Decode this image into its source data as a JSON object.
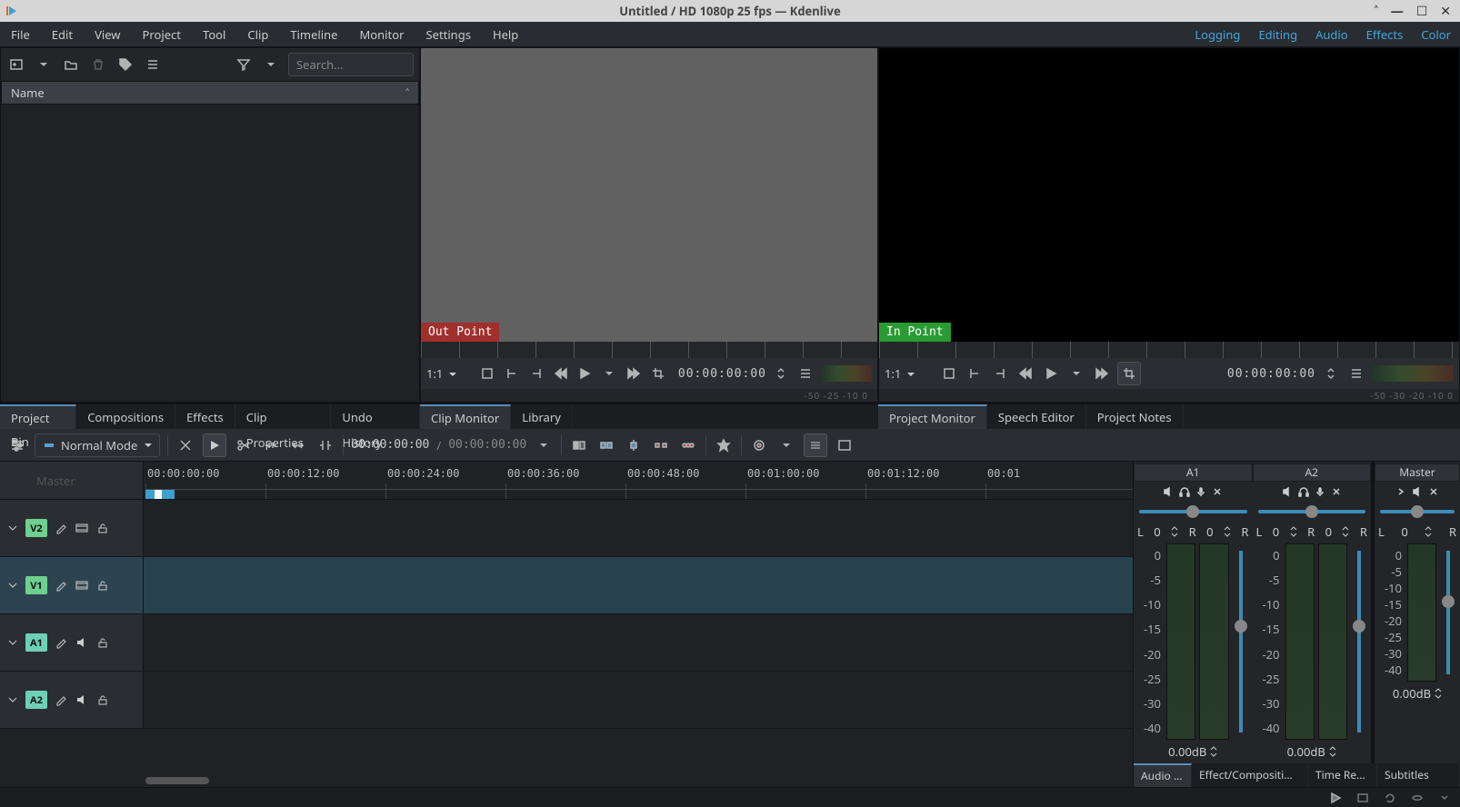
{
  "window": {
    "title": "Untitled / HD 1080p 25 fps — Kdenlive"
  },
  "menu": [
    "File",
    "Edit",
    "View",
    "Project",
    "Tool",
    "Clip",
    "Timeline",
    "Monitor",
    "Settings",
    "Help"
  ],
  "workspaces": [
    "Logging",
    "Editing",
    "Audio",
    "Effects",
    "Color"
  ],
  "bin": {
    "search_placeholder": "Search...",
    "column_header": "Name"
  },
  "clip_monitor": {
    "tag": "Out Point",
    "zoom": "1:1",
    "timecode": "00:00:00:00",
    "levels_label": "-50 -25 -10 0"
  },
  "project_monitor": {
    "tag": "In Point",
    "zoom": "1:1",
    "timecode": "00:00:00:00",
    "levels_label": "-50 -30 -20 -10  0"
  },
  "tabs_left": [
    "Project Bin",
    "Compositions",
    "Effects",
    "Clip Properties",
    "Undo History"
  ],
  "tabs_mid": [
    "Clip Monitor",
    "Library"
  ],
  "tabs_right": [
    "Project Monitor",
    "Speech Editor",
    "Project Notes"
  ],
  "timeline_toolbar": {
    "mode": "Normal Mode",
    "tc1": "00:00:00:00",
    "tc2": "00:00:00:00"
  },
  "ruler": {
    "head_label": "Master",
    "ticks": [
      "00:00:00:00",
      "00:00:12:00",
      "00:00:24:00",
      "00:00:36:00",
      "00:00:48:00",
      "00:01:00:00",
      "00:01:12:00",
      "00:01"
    ]
  },
  "tracks": [
    {
      "id": "V2",
      "kind": "v",
      "target": false
    },
    {
      "id": "V1",
      "kind": "v",
      "target": true
    },
    {
      "id": "A1",
      "kind": "a",
      "target": false
    },
    {
      "id": "A2",
      "kind": "a",
      "target": false
    }
  ],
  "mixer": {
    "channels": [
      {
        "name": "A1",
        "L": "L",
        "Lval": "0",
        "R": "R",
        "Rval": "0",
        "db": "0.00dB"
      },
      {
        "name": "A2",
        "L": "L",
        "Lval": "0",
        "R": "R",
        "Rval": "0",
        "db": "0.00dB"
      }
    ],
    "master": {
      "name": "Master",
      "L": "L",
      "Lval": "0",
      "R": "R",
      "Rval": "0",
      "db": "0.00dB"
    },
    "scale": [
      "0",
      "-5",
      "-10",
      "-15",
      "-20",
      "-25",
      "-30",
      "-40"
    ],
    "tabs": [
      "Audio …",
      "Effect/Compositi…",
      "Time Re…",
      "Subtitles"
    ]
  }
}
